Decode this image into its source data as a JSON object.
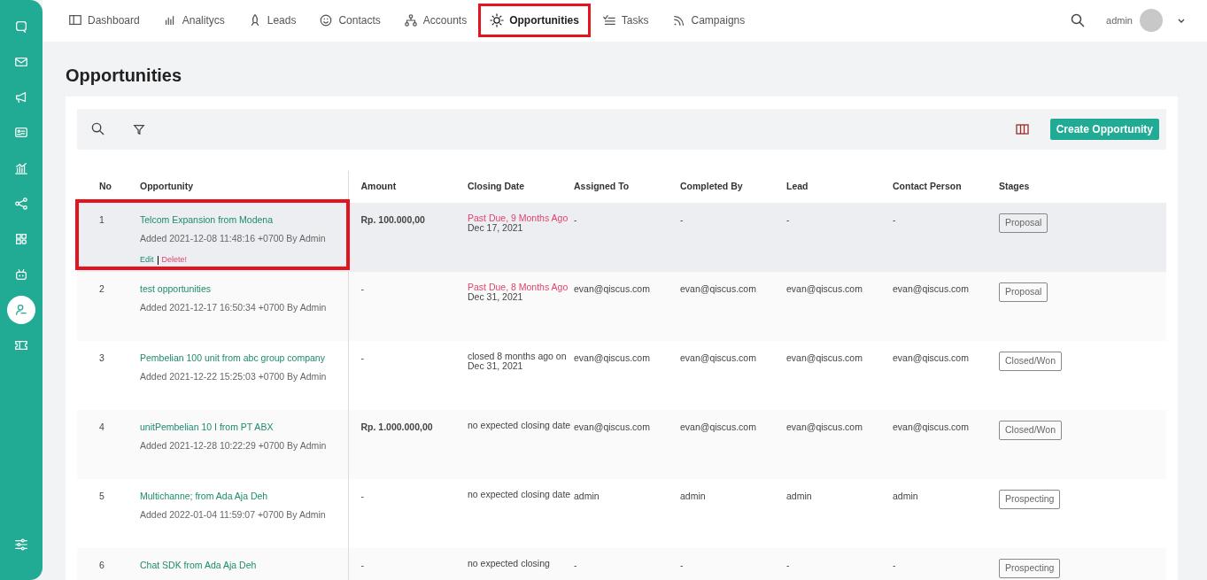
{
  "sidebar": {
    "items": [
      {
        "selected": false
      },
      {
        "selected": false
      },
      {
        "selected": false
      },
      {
        "selected": false
      },
      {
        "selected": false
      },
      {
        "selected": false
      },
      {
        "selected": false
      },
      {
        "selected": false
      },
      {
        "selected": true
      },
      {
        "selected": false
      }
    ]
  },
  "nav": {
    "items": [
      {
        "label": "Dashboard",
        "selected": false,
        "highlighted": false
      },
      {
        "label": "Analitycs",
        "selected": false,
        "highlighted": false
      },
      {
        "label": "Leads",
        "selected": false,
        "highlighted": false
      },
      {
        "label": "Contacts",
        "selected": false,
        "highlighted": false
      },
      {
        "label": "Accounts",
        "selected": false,
        "highlighted": false
      },
      {
        "label": "Opportunities",
        "selected": true,
        "highlighted": true
      },
      {
        "label": "Tasks",
        "selected": false,
        "highlighted": false
      },
      {
        "label": "Campaigns",
        "selected": false,
        "highlighted": false
      }
    ],
    "user": "admin"
  },
  "page_title": "Opportunities",
  "toolbar": {
    "create_button": "Create Opportunity"
  },
  "table": {
    "columns": [
      "No",
      "Opportunity",
      "Amount",
      "Closing Date",
      "Assigned To",
      "Completed By",
      "Lead",
      "Contact Person",
      "Stages"
    ],
    "rows": [
      {
        "no": "1",
        "title": "Telcom Expansion from Modena",
        "added": "Added 2021-12-08 11:48:16 +0700 By Admin",
        "actions": [
          "Edit",
          "Delete!"
        ],
        "amount": "Rp. 100.000,00",
        "closing": [
          "Past Due, 9 Months Ago",
          "Dec 17, 2021"
        ],
        "overdue": true,
        "assigned": "-",
        "completed": "-",
        "lead": "-",
        "contact": "-",
        "stage": "Proposal",
        "hovered": true,
        "highlighted": true
      },
      {
        "no": "2",
        "title": "test opportunities",
        "added": "Added 2021-12-17 16:50:34 +0700 By Admin",
        "amount": "-",
        "closing": [
          "Past Due, 8 Months Ago",
          "Dec 31, 2021"
        ],
        "overdue": true,
        "assigned": "evan@qiscus.com",
        "completed": "evan@qiscus.com",
        "lead": "evan@qiscus.com",
        "contact": "evan@qiscus.com",
        "stage": "Proposal",
        "hovered": false,
        "highlighted": false
      },
      {
        "no": "3",
        "title": "Pembelian 100 unit from abc group company",
        "added": "Added 2021-12-22 15:25:03 +0700 By Admin",
        "amount": "-",
        "closing": [
          "closed 8 months ago on Dec 31, 2021"
        ],
        "overdue": false,
        "assigned": "evan@qiscus.com",
        "completed": "evan@qiscus.com",
        "lead": "evan@qiscus.com",
        "contact": "evan@qiscus.com",
        "stage": "Closed/Won",
        "hovered": false,
        "highlighted": false
      },
      {
        "no": "4",
        "title": "unitPembelian 10 I from PT ABX",
        "added": "Added 2021-12-28 10:22:29 +0700 By Admin",
        "amount": "Rp. 1.000.000,00",
        "closing": [
          "no expected closing date"
        ],
        "overdue": false,
        "assigned": "evan@qiscus.com",
        "completed": "evan@qiscus.com",
        "lead": "evan@qiscus.com",
        "contact": "evan@qiscus.com",
        "stage": "Closed/Won",
        "hovered": false,
        "highlighted": false
      },
      {
        "no": "5",
        "title": "Multichanne; from Ada Aja Deh",
        "added": "Added 2022-01-04 11:59:07 +0700 By Admin",
        "amount": "-",
        "closing": [
          "no expected closing date"
        ],
        "overdue": false,
        "assigned": "admin",
        "completed": "admin",
        "lead": "admin",
        "contact": "admin",
        "stage": "Prospecting",
        "hovered": false,
        "highlighted": false
      },
      {
        "no": "6",
        "title": "Chat SDK from Ada Aja Deh",
        "amount": "-",
        "closing": [
          "no expected closing"
        ],
        "overdue": false,
        "assigned": "-",
        "completed": "-",
        "lead": "-",
        "contact": "-",
        "stage": "Prospecting",
        "hovered": false,
        "highlighted": false
      }
    ]
  }
}
